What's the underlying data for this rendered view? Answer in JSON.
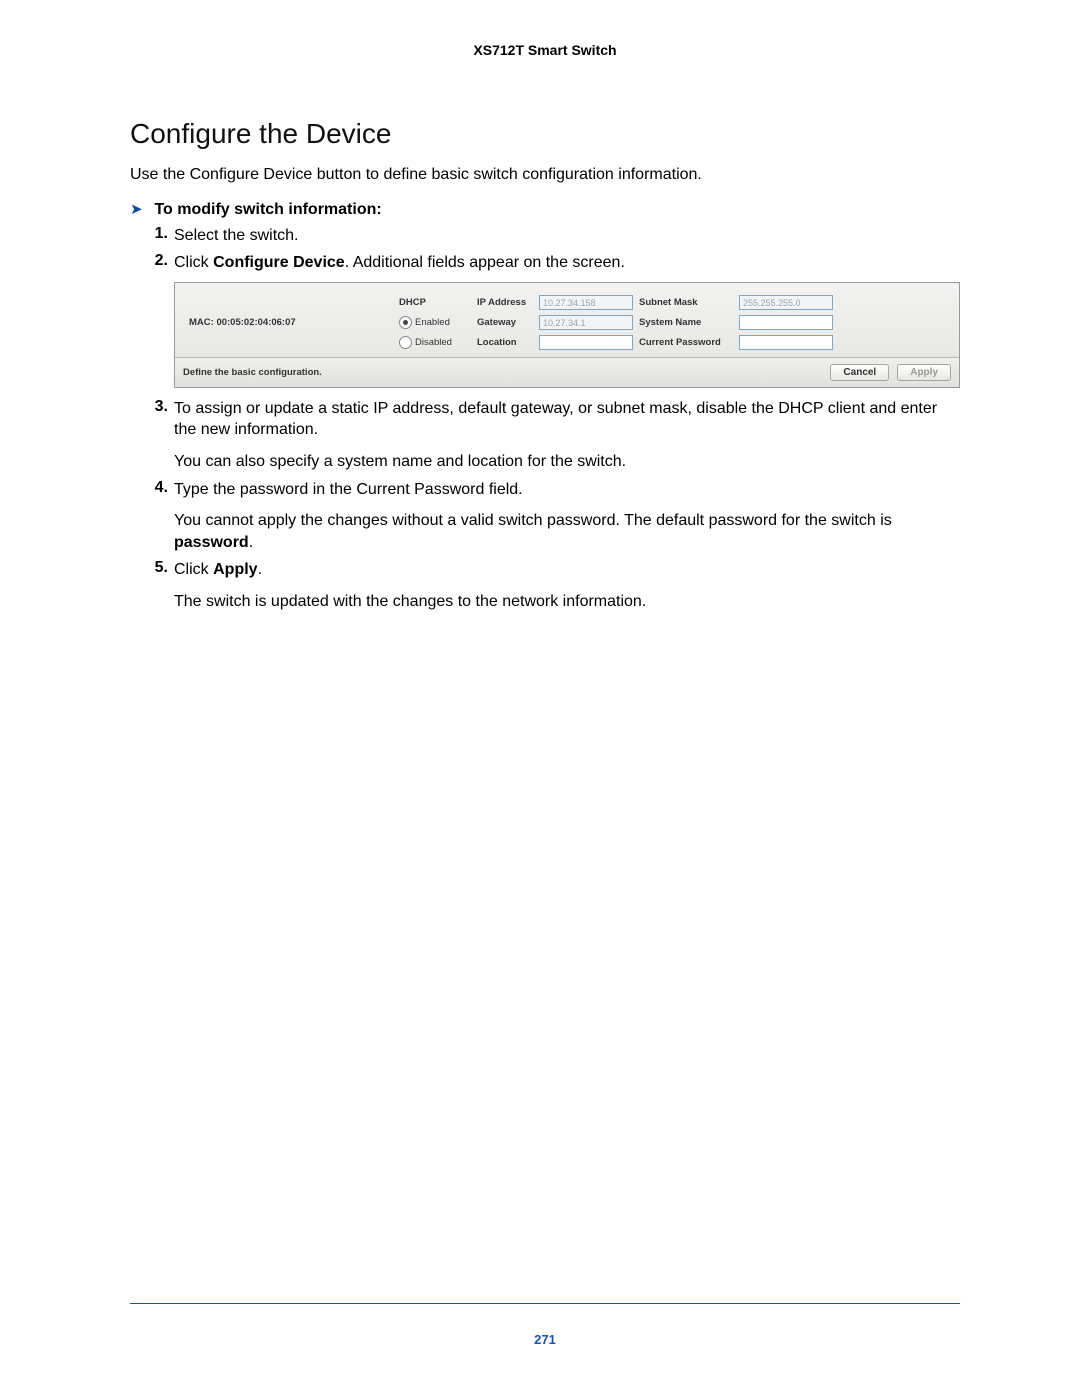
{
  "header": {
    "product": "XS712T Smart Switch"
  },
  "section": {
    "heading": "Configure the Device"
  },
  "intro": "Use the Configure Device button to define basic switch configuration information.",
  "procedure": {
    "title": "To modify switch information:"
  },
  "steps": {
    "s1": {
      "num": "1.",
      "text": "Select the switch."
    },
    "s2": {
      "num": "2.",
      "prefix": "Click ",
      "bold": "Configure Device",
      "suffix": ". Additional fields appear on the screen."
    },
    "s3": {
      "num": "3.",
      "p1": "To assign or update a static IP address, default gateway, or subnet mask, disable the DHCP client and enter the new information.",
      "p2": "You can also specify a system name and location for the switch."
    },
    "s4": {
      "num": "4.",
      "p1": "Type the password in the Current Password field.",
      "p2a": "You cannot apply the changes without a valid switch password. The default password for the switch is ",
      "p2b": "password",
      "p2c": "."
    },
    "s5": {
      "num": "5.",
      "p1a": "Click ",
      "p1b": "Apply",
      "p1c": ".",
      "p2": "The switch is updated with the changes to the network information."
    }
  },
  "ui": {
    "mac_label": "MAC: 00:05:02:04:06:07",
    "dhcp_label": "DHCP",
    "dhcp_enabled": "Enabled",
    "dhcp_disabled": "Disabled",
    "ip_label": "IP Address",
    "ip_value": "10.27.34.158",
    "gateway_label": "Gateway",
    "gateway_value": "10.27.34.1",
    "location_label": "Location",
    "location_value": "",
    "subnet_label": "Subnet Mask",
    "subnet_value": "255.255.255.0",
    "sysname_label": "System Name",
    "sysname_value": "",
    "curpw_label": "Current Password",
    "curpw_value": "",
    "footer_hint": "Define the basic configuration.",
    "cancel": "Cancel",
    "apply": "Apply"
  },
  "footer": {
    "page_number": "271"
  }
}
